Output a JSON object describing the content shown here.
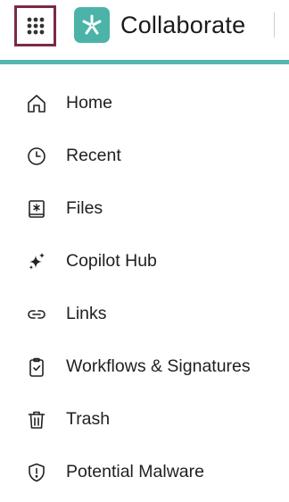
{
  "header": {
    "app_title": "Collaborate",
    "apps_icon": "grid-9-dots-icon",
    "logo_icon": "asterisk-logo-icon"
  },
  "colors": {
    "accent": "#57b5ad",
    "logo_bg": "#4bb3a8",
    "focus_border": "#7a2a4a",
    "text": "#1f1f1f"
  },
  "nav": {
    "items": [
      {
        "label": "Home",
        "icon": "home-icon"
      },
      {
        "label": "Recent",
        "icon": "clock-icon"
      },
      {
        "label": "Files",
        "icon": "file-box-icon"
      },
      {
        "label": "Copilot Hub",
        "icon": "sparkles-icon"
      },
      {
        "label": "Links",
        "icon": "link-icon"
      },
      {
        "label": "Workflows & Signatures",
        "icon": "clipboard-check-icon"
      },
      {
        "label": "Trash",
        "icon": "trash-icon"
      },
      {
        "label": "Potential Malware",
        "icon": "shield-alert-icon"
      }
    ]
  }
}
